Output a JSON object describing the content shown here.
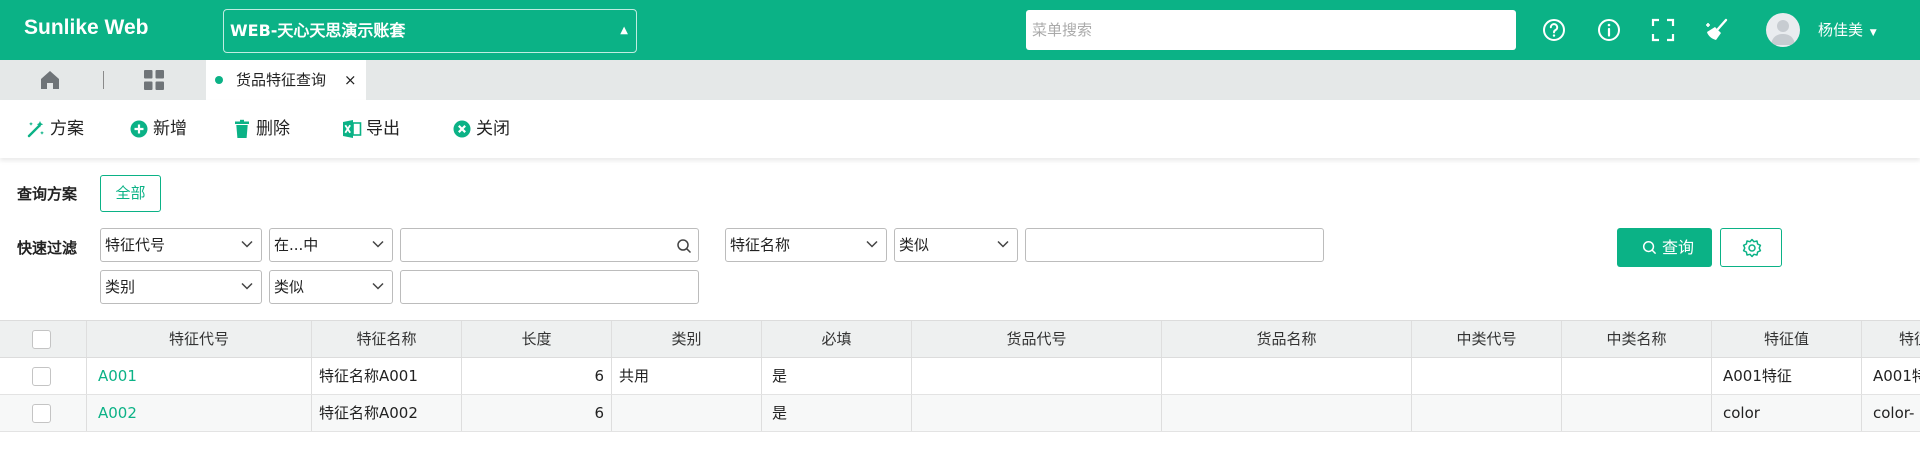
{
  "app": {
    "title": "Sunlike Web",
    "account": "WEB-天心天思演示账套",
    "menu_search_placeholder": "菜单搜索",
    "user_name": "杨佳美"
  },
  "tabs": [
    {
      "label": "货品特征查询",
      "active": true,
      "close": "×"
    }
  ],
  "toolbar": {
    "plan": "方案",
    "add": "新增",
    "delete": "删除",
    "export": "导出",
    "close": "关闭"
  },
  "query": {
    "plan_label": "查询方案",
    "plan_all": "全部",
    "filter_label": "快速过滤",
    "filters": [
      {
        "field": "特征代号",
        "op": "在...中",
        "value": ""
      },
      {
        "field": "特征名称",
        "op": "类似",
        "value": ""
      },
      {
        "field": "类别",
        "op": "类似",
        "value": ""
      }
    ],
    "search_button": "查询"
  },
  "grid": {
    "columns": [
      "特征代号",
      "特征名称",
      "长度",
      "类别",
      "必填",
      "货品代号",
      "货品名称",
      "中类代号",
      "中类名称",
      "特征值",
      "特征"
    ],
    "rows": [
      {
        "code": "A001",
        "name": "特征名称A001",
        "length": "6",
        "category": "共用",
        "required": "是",
        "item_code": "",
        "item_name": "",
        "mid_code": "",
        "mid_name": "",
        "value": "A001特征",
        "extra": "A001特"
      },
      {
        "code": "A002",
        "name": "特征名称A002",
        "length": "6",
        "category": "",
        "required": "是",
        "item_code": "",
        "item_name": "",
        "mid_code": "",
        "mid_name": "",
        "value": "color",
        "extra": "color-"
      }
    ]
  },
  "colors": {
    "brand": "#0bb286",
    "tabbar": "#e5e8e8",
    "grid_header": "#eef0f0"
  },
  "icons": {
    "topbar": [
      "help-circle-icon",
      "info-circle-icon",
      "fullscreen-icon",
      "broom-icon"
    ],
    "tabbar": [
      "home-icon",
      "grid-icon"
    ]
  }
}
